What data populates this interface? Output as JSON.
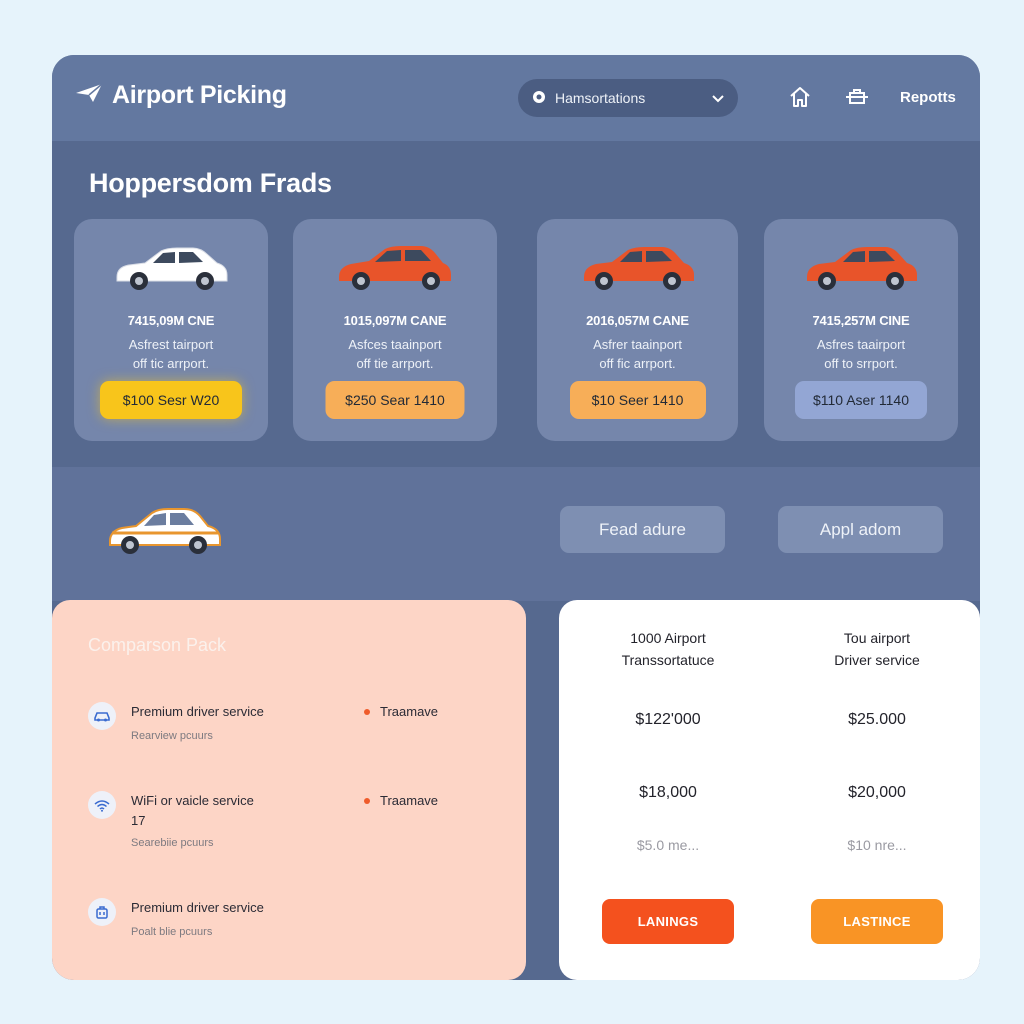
{
  "header": {
    "brand_title": "Airport Picking",
    "brand_icon": "plane-icon",
    "selector_value": "Hamsortations",
    "nav_reports": "Repotts"
  },
  "hero": {
    "title": "Hoppersdom Frads",
    "cards": [
      {
        "code": "7415,09M CNE",
        "desc_line1": "Asfrest tairport",
        "desc_line2": "off tic arrport.",
        "button": "$100 Sesr W20",
        "car_color": "#ffffff",
        "button_color": "#f8c51b"
      },
      {
        "code": "1015,097M CANE",
        "desc_line1": "Asfces taainport",
        "desc_line2": "off tie arrport.",
        "button": "$250 Sear 1410",
        "car_color": "#e8542a",
        "button_color": "#f7ae58"
      },
      {
        "code": "2016,057M CANE",
        "desc_line1": "Asfrer taainport",
        "desc_line2": "off fic arrport.",
        "button": "$10 Seer 1410",
        "car_color": "#e8542a",
        "button_color": "#f7ae58"
      },
      {
        "code": "7415,257M CINE",
        "desc_line1": "Asfres taairport",
        "desc_line2": "off to srrport.",
        "button": "$110 Aser 1140",
        "car_color": "#e8542a",
        "button_color": "#93a6d4"
      }
    ]
  },
  "actions": {
    "primary": "Fead adure",
    "secondary": "Appl adom"
  },
  "comparison": {
    "title": "Comparson Pack",
    "features": [
      {
        "icon": "car-icon",
        "name": "Premium driver service",
        "sub": "Rearview pcuurs",
        "tag": "Traamave"
      },
      {
        "icon": "wifi-icon",
        "name": "WiFi or vaicle service",
        "name_line2": "17",
        "sub": "Searebiie pcuurs",
        "tag": "Traamave"
      },
      {
        "icon": "luggage-icon",
        "name": "Premium driver service",
        "sub": "Poalt blie pcuurs",
        "tag": ""
      }
    ]
  },
  "pricing": {
    "columns": [
      {
        "head_line1": "1000 Airport",
        "head_line2": "Transsortatuce",
        "price1": "$122'000",
        "price2": "$18,000",
        "note": "$5.0 me...",
        "button": "LANINGS",
        "button_color": "#f4511e"
      },
      {
        "head_line1": "Tou airport",
        "head_line2": "Driver service",
        "price1": "$25.000",
        "price2": "$20,000",
        "note": "$10 nre...",
        "button": "LASTINCE",
        "button_color": "#f99425"
      }
    ]
  }
}
